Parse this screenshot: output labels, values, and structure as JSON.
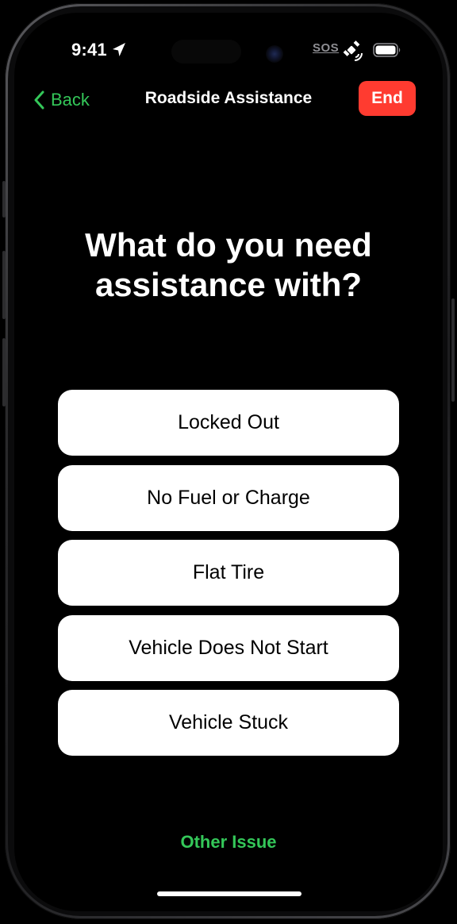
{
  "status_bar": {
    "time": "9:41",
    "sos": "SOS",
    "icons": [
      "location-arrow-icon",
      "satellite-icon",
      "battery-icon"
    ]
  },
  "nav": {
    "back_label": "Back",
    "title": "Roadside Assistance",
    "end_label": "End"
  },
  "main": {
    "question": "What do you need\nassistance with?",
    "options": [
      {
        "label": "Locked Out"
      },
      {
        "label": "No Fuel or Charge"
      },
      {
        "label": "Flat Tire"
      },
      {
        "label": "Vehicle Does Not Start"
      },
      {
        "label": "Vehicle Stuck"
      }
    ],
    "other_label": "Other Issue"
  },
  "colors": {
    "accent": "#34c759",
    "danger": "#ff3b30",
    "background": "#000000",
    "option_bg": "#ffffff"
  }
}
